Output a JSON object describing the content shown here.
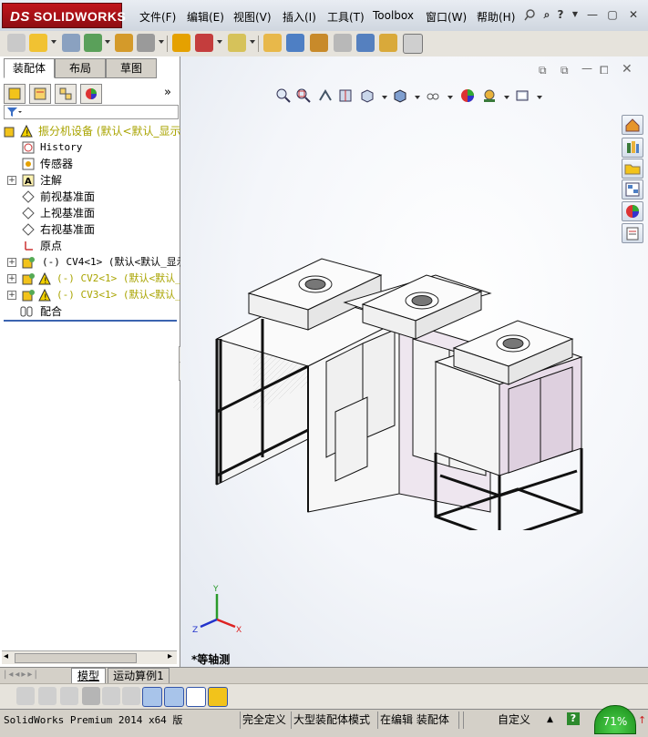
{
  "app": {
    "logo": "SOLIDWORKS",
    "logo_prefix": "DS"
  },
  "menu": {
    "file": "文件(F)",
    "edit": "编辑(E)",
    "view": "视图(V)",
    "insert": "插入(I)",
    "tools": "工具(T)",
    "toolbox": "Toolbox",
    "window": "窗口(W)",
    "help": "帮助(H)"
  },
  "window_controls": [
    "pin-icon",
    "help-icon",
    "minimize-icon",
    "restore-icon",
    "close-icon"
  ],
  "panel_tabs": {
    "assembly": "装配体",
    "layout": "布局",
    "sketch": "草图"
  },
  "feature_tree": {
    "root": "振分机设备  (默认<默认_显示",
    "items": [
      {
        "label": "History",
        "icon": "history-icon"
      },
      {
        "label": "传感器",
        "icon": "sensor-icon"
      },
      {
        "label": "注解",
        "icon": "annotation-icon"
      },
      {
        "label": "前视基准面",
        "icon": "plane-icon"
      },
      {
        "label": "上视基准面",
        "icon": "plane-icon"
      },
      {
        "label": "右视基准面",
        "icon": "plane-icon"
      },
      {
        "label": "原点",
        "icon": "origin-icon"
      },
      {
        "label": "(-) CV4<1>  (默认<默认_显示",
        "icon": "part-icon"
      },
      {
        "label": "(-) CV2<1>  (默认<默认_显",
        "icon": "part-warning-icon"
      },
      {
        "label": "(-) CV3<1>  (默认<默认_显",
        "icon": "part-warning-icon"
      },
      {
        "label": "配合",
        "icon": "mates-icon"
      }
    ]
  },
  "bottom_tabs": {
    "model": "模型",
    "motion": "运动算例1"
  },
  "view_label": "*等轴测",
  "triad": {
    "x": "X",
    "y": "Y",
    "z": "Z"
  },
  "status": {
    "version": "SolidWorks Premium 2014 x64 版",
    "fully_defined": "完全定义",
    "large_assembly": "大型装配体模式",
    "editing": "在编辑 装配体",
    "custom": "自定义",
    "progress": "71%"
  },
  "colors": {
    "brand_red": "#b3121a",
    "warning_yellow": "#e5c100",
    "cabinet_panel": "#d9cddb",
    "frame": "#1a1a1a"
  }
}
